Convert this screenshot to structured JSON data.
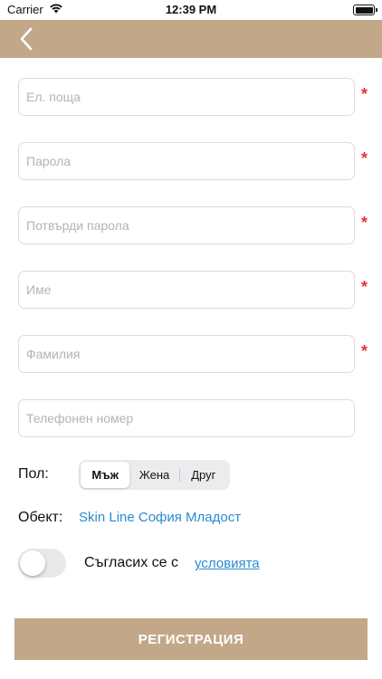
{
  "status_bar": {
    "carrier": "Carrier",
    "time": "12:39 PM",
    "icons": [
      "wifi-icon",
      "battery-icon"
    ]
  },
  "nav": {
    "back_icon": "chevron-left-icon"
  },
  "form": {
    "fields": [
      {
        "placeholder": "Ел. поща",
        "value": "",
        "required": true,
        "required_mark": "*"
      },
      {
        "placeholder": "Парола",
        "value": "",
        "required": true,
        "required_mark": "*"
      },
      {
        "placeholder": "Потвърди парола",
        "value": "",
        "required": true,
        "required_mark": "*"
      },
      {
        "placeholder": "Име",
        "value": "",
        "required": true,
        "required_mark": "*"
      },
      {
        "placeholder": "Фамилия",
        "value": "",
        "required": true,
        "required_mark": "*"
      },
      {
        "placeholder": "Телефонен номер",
        "value": "",
        "required": false
      }
    ],
    "gender": {
      "label": "Пол:",
      "options": [
        "Мъж",
        "Жена",
        "Друг"
      ],
      "selected": "Мъж"
    },
    "object": {
      "label": "Обект:",
      "value": "Skin Line София Младост"
    },
    "terms": {
      "toggle_on": false,
      "text": "Съгласих се с",
      "link": "условията"
    },
    "submit_label": "РЕГИСТРАЦИЯ"
  },
  "colors": {
    "accent": "#c2a888",
    "required": "#e3342f",
    "link": "#2a8bd1",
    "field_border": "#dcdcdc"
  }
}
